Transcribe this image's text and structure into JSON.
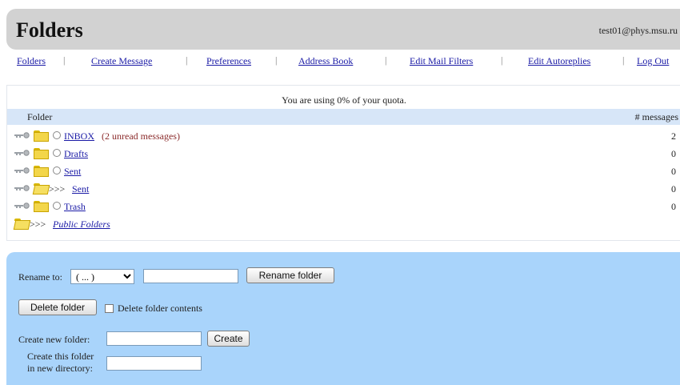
{
  "header": {
    "title": "Folders",
    "user": "test01@phys.msu.ru"
  },
  "nav": {
    "separator": "|",
    "items": [
      "Folders",
      "Create Message",
      "Preferences",
      "Address Book",
      "Edit Mail Filters",
      "Edit Autoreplies",
      "Log Out"
    ]
  },
  "quota": {
    "text": "You are using 0% of your quota."
  },
  "table": {
    "col_folder": "Folder",
    "col_messages": "# messages",
    "rows": [
      {
        "name": "INBOX",
        "note": "(2 unread messages)",
        "count": "2"
      },
      {
        "name": "Drafts",
        "count": "0"
      },
      {
        "name": "Sent",
        "count": "0"
      },
      {
        "prefix": ">>>",
        "name": "Sent",
        "count": "0"
      },
      {
        "name": "Trash",
        "count": "0"
      },
      {
        "prefix": ">>>",
        "name": "Public Folders"
      }
    ]
  },
  "icons": {
    "key": "key-icon",
    "folder": "folder-icon",
    "folder_open": "folder-open-icon"
  },
  "colors": {
    "bottom_panel": "#a9d4fb",
    "header_bg": "#d2d2d2",
    "table_header_bg": "#d7e6f8",
    "link": "#1a1aa6",
    "unread": "#8b2b2b"
  },
  "actions": {
    "rename_label": "Rename to:",
    "rename_select_value": "( ... )",
    "rename_button": "Rename folder",
    "delete_button": "Delete folder",
    "delete_contents_label": "Delete folder contents",
    "create_label": "Create new folder:",
    "create_button": "Create",
    "create_dir_label_1": "Create this folder",
    "create_dir_label_2": "in new directory:"
  }
}
